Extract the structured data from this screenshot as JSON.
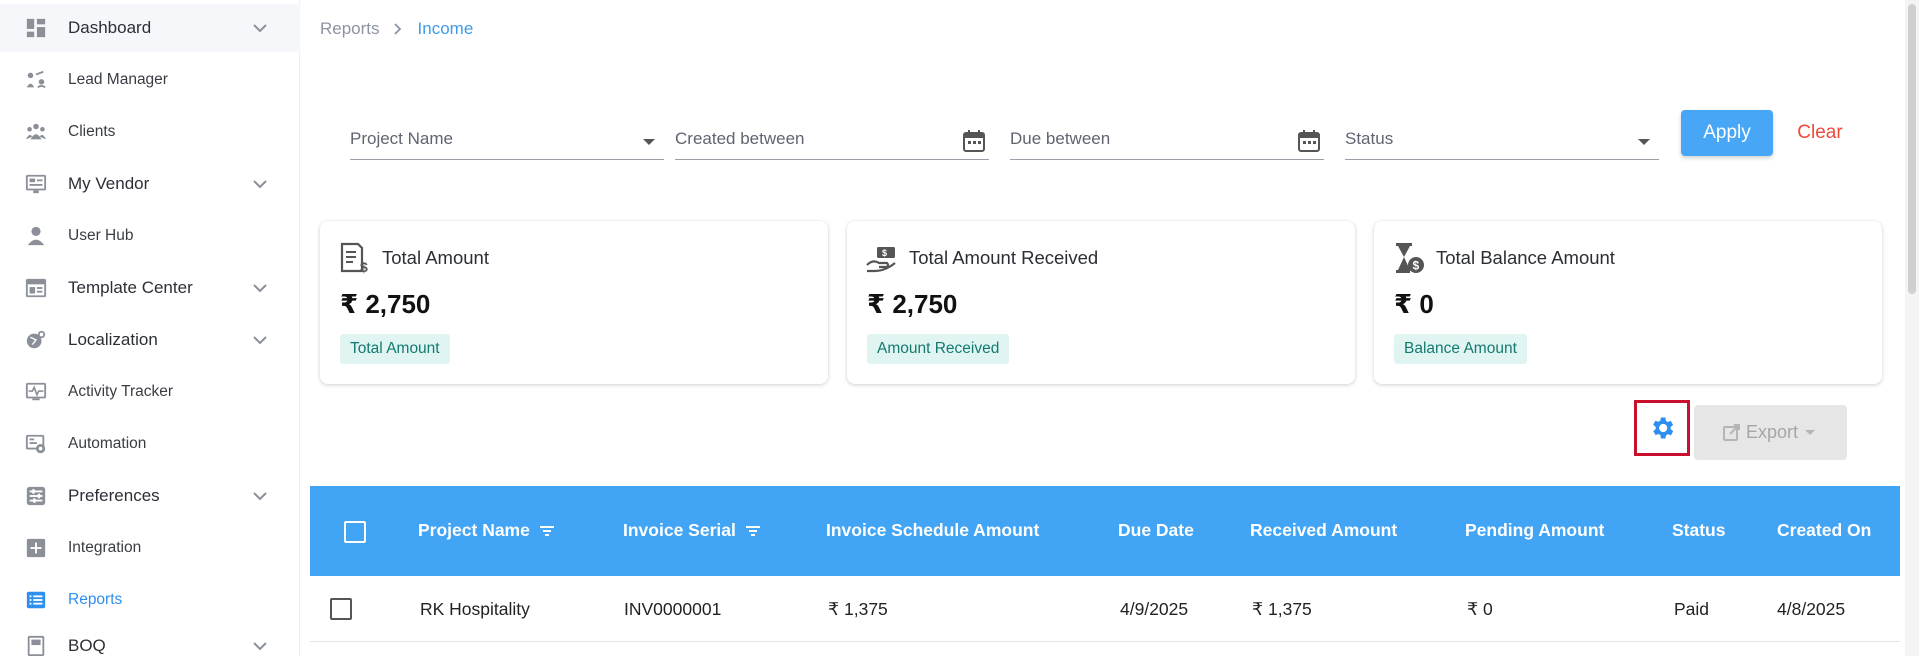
{
  "sidebar": {
    "items": [
      {
        "label": "Dashboard",
        "icon": "dashboard-icon",
        "expandable": true
      },
      {
        "label": "Lead Manager",
        "icon": "lead-manager-icon",
        "expandable": false
      },
      {
        "label": "Clients",
        "icon": "clients-icon",
        "expandable": false
      },
      {
        "label": "My Vendor",
        "icon": "vendor-icon",
        "expandable": true
      },
      {
        "label": "User Hub",
        "icon": "user-icon",
        "expandable": false
      },
      {
        "label": "Template Center",
        "icon": "template-icon",
        "expandable": true
      },
      {
        "label": "Localization",
        "icon": "localization-icon",
        "expandable": true
      },
      {
        "label": "Activity Tracker",
        "icon": "activity-icon",
        "expandable": false
      },
      {
        "label": "Automation",
        "icon": "automation-icon",
        "expandable": false
      },
      {
        "label": "Preferences",
        "icon": "preferences-icon",
        "expandable": true
      },
      {
        "label": "Integration",
        "icon": "integration-icon",
        "expandable": false
      },
      {
        "label": "Reports",
        "icon": "reports-icon",
        "expandable": false,
        "selected": true
      },
      {
        "label": "BOQ",
        "icon": "boq-icon",
        "expandable": true
      }
    ]
  },
  "breadcrumb": {
    "root": "Reports",
    "current": "Income"
  },
  "filters": {
    "project_name": "Project Name",
    "created_between": "Created between",
    "due_between": "Due between",
    "status": "Status",
    "apply_label": "Apply",
    "clear_label": "Clear"
  },
  "cards": [
    {
      "title": "Total Amount",
      "value": "₹ 2,750",
      "badge": "Total Amount",
      "icon": "invoice-dollar-icon"
    },
    {
      "title": "Total Amount Received",
      "value": "₹ 2,750",
      "badge": "Amount Received",
      "icon": "hand-money-icon"
    },
    {
      "title": "Total Balance Amount",
      "value": "₹ 0",
      "badge": "Balance Amount",
      "icon": "hourglass-dollar-icon"
    }
  ],
  "toolbar": {
    "settings_icon": "gear-icon",
    "export_label": "Export"
  },
  "table": {
    "columns": [
      "Project Name",
      "Invoice Serial",
      "Invoice Schedule Amount",
      "Due Date",
      "Received Amount",
      "Pending Amount",
      "Status",
      "Created On"
    ],
    "rows": [
      [
        "RK Hospitality",
        "INV0000001",
        "₹ 1,375",
        "4/9/2025",
        "₹ 1,375",
        "₹ 0",
        "Paid",
        "4/8/2025"
      ]
    ]
  },
  "colors": {
    "accent": "#42a4f5",
    "apply": "#47a6f5",
    "clear": "#ee4a3a",
    "badge_bg": "#e0f4f2",
    "badge_text": "#137a6f",
    "highlight": "#c8102e"
  }
}
